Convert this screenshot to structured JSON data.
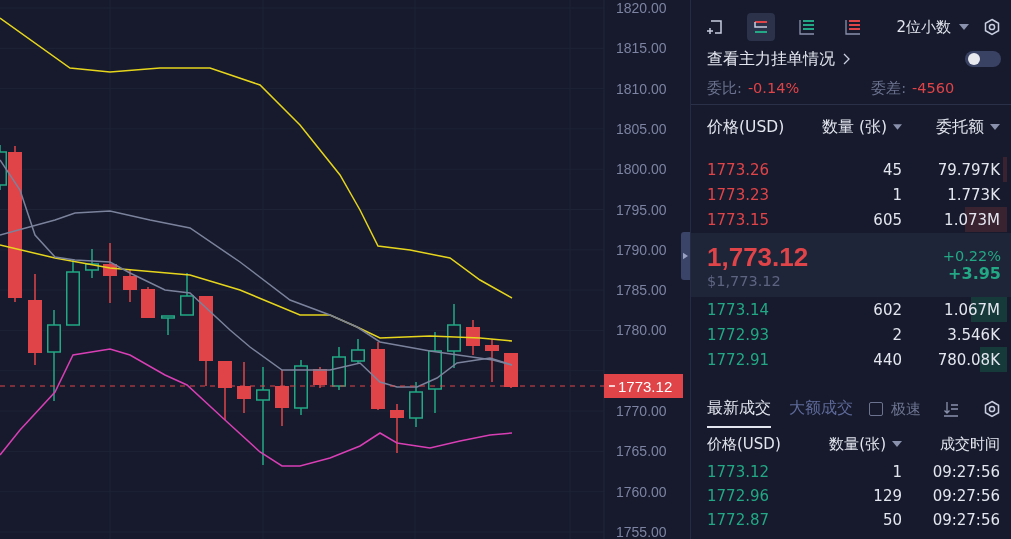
{
  "chart": {
    "yticks_upper": [
      "1820.00",
      "1815.00",
      "1810.00",
      "1805.00",
      "1800.00",
      "1795.00",
      "1790.00",
      "1785.00",
      "1780.00"
    ],
    "yticks_lower": [
      "1770.00",
      "1765.00",
      "1760.00",
      "1755.00"
    ],
    "last_price": "1773.12"
  },
  "order_book": {
    "toolbar": [
      {
        "kind": "expand",
        "selected": false
      },
      {
        "kind": "both",
        "selected": true
      },
      {
        "kind": "bids",
        "selected": false
      },
      {
        "kind": "asks",
        "selected": false
      }
    ],
    "precision": "2位小数",
    "link": "查看主力挂单情况",
    "toggle_on": false,
    "ratio_label": "委比:",
    "ratio": "-0.14%",
    "diff_label": "委差:",
    "diff": "-4560",
    "columns": [
      {
        "label": "价格(USD)",
        "dropdown": false
      },
      {
        "label": "数量 (张)",
        "dropdown": true
      },
      {
        "label": "委托额",
        "dropdown": true
      }
    ],
    "asks": [
      {
        "price": "1773.26",
        "qty": "45",
        "amount": "79.797K"
      },
      {
        "price": "1773.23",
        "qty": "1",
        "amount": "1.773K"
      },
      {
        "price": "1773.15",
        "qty": "605",
        "amount": "1.073M"
      }
    ],
    "last": {
      "price": "1,773.12",
      "usd": "$1,773.12",
      "change_pct": "+0.22%",
      "change": "+3.95"
    },
    "bids": [
      {
        "price": "1773.14",
        "qty": "602",
        "amount": "1.067M"
      },
      {
        "price": "1772.93",
        "qty": "2",
        "amount": "3.546K"
      },
      {
        "price": "1772.91",
        "qty": "440",
        "amount": "780.08K"
      }
    ]
  },
  "trades": {
    "tabs": [
      {
        "label": "最新成交",
        "selected": true
      },
      {
        "label": "大额成交",
        "selected": false
      }
    ],
    "fast": {
      "label": "极速",
      "checked": false
    },
    "columns": [
      {
        "label": "价格(USD)",
        "dropdown": false
      },
      {
        "label": "数量(张)",
        "dropdown": true
      },
      {
        "label": "成交时间",
        "dropdown": false
      }
    ],
    "rows": [
      {
        "price": "1773.12",
        "qty": "1",
        "time": "09:27:56"
      },
      {
        "price": "1772.96",
        "qty": "129",
        "time": "09:27:56"
      },
      {
        "price": "1772.87",
        "qty": "50",
        "time": "09:27:56"
      }
    ]
  }
}
